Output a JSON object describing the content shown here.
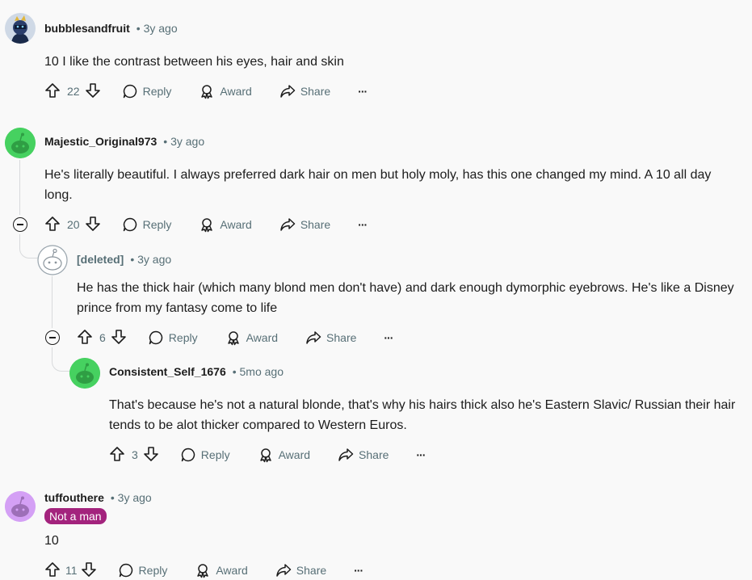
{
  "action_labels": {
    "reply": "Reply",
    "award": "Award",
    "share": "Share",
    "more": "···"
  },
  "colors": {
    "flair_bg": "#a3237d",
    "snoo_green": "#46d160",
    "snoo_purple": "#d4a0f5"
  },
  "comments": [
    {
      "username": "bubblesandfruit",
      "age": "• 3y ago",
      "avatar_icon": "custom-avatar-icon",
      "body": "10 I like the contrast between his eyes, hair and skin",
      "score": "22"
    },
    {
      "username": "Majestic_Original973",
      "age": "• 3y ago",
      "avatar_icon": "snoo-green-avatar-icon",
      "body": "He's literally beautiful. I always preferred dark hair on men but holy moly, has this one changed my mind. A 10 all day long.",
      "score": "20"
    },
    {
      "username": "[deleted]",
      "age": "• 3y ago",
      "avatar_icon": "deleted-avatar-icon",
      "body": "He has the thick hair (which many blond men don't have) and dark enough dymorphic eyebrows. He's like a Disney prince from my fantasy come to life",
      "score": "6"
    },
    {
      "username": "Consistent_Self_1676",
      "age": "• 5mo ago",
      "avatar_icon": "snoo-green-avatar-icon",
      "body": "That's because he's not a natural blonde,  that's why his hairs thick also he's Eastern Slavic/ Russian their hair tends to be alot thicker compared to Western Euros.",
      "score": "3"
    },
    {
      "username": "tuffouthere",
      "age": "• 3y ago",
      "avatar_icon": "snoo-purple-avatar-icon",
      "flair": "Not a man",
      "body": "10",
      "score": "11"
    }
  ]
}
